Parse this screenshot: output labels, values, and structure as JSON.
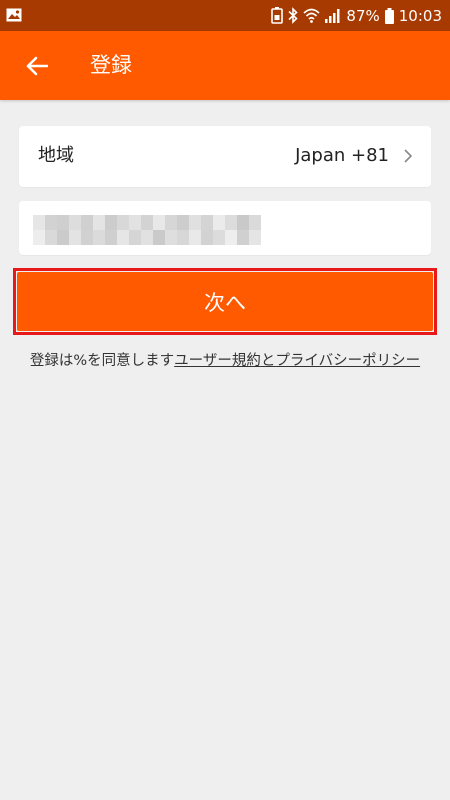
{
  "status_bar": {
    "battery_percent": "87%",
    "time": "10:03",
    "icons": [
      "gallery-icon",
      "battery-saver-icon",
      "bluetooth-icon",
      "wifi-icon",
      "signal-icon",
      "battery-icon"
    ]
  },
  "app_bar": {
    "title": "登録",
    "back_icon": "arrow-left-icon"
  },
  "region": {
    "label": "地域",
    "value": "Japan +81"
  },
  "phone": {
    "value": "",
    "placeholder": "",
    "obscured": true
  },
  "next_button": {
    "label": "次へ",
    "highlighted": true
  },
  "terms": {
    "prefix": "登録は%を同意します",
    "link_user_agreement": "ユーザー規約",
    "connector": "と",
    "link_privacy_policy": "プライバシーポリシー"
  },
  "colors": {
    "status_bar": "#a73a00",
    "app_bar": "#ff5a00",
    "accent": "#ff5a00",
    "highlight_outline": "#e8191a",
    "background": "#efefef"
  }
}
